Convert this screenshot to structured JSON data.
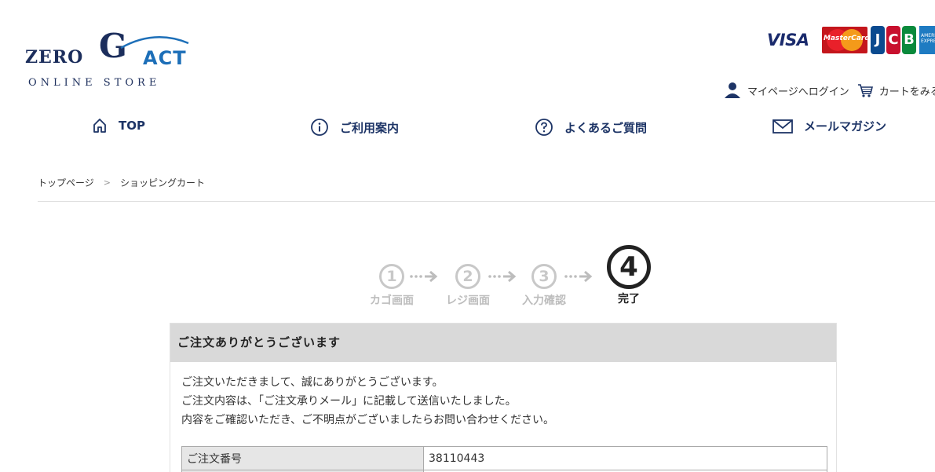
{
  "logo": {
    "main": "ZERO",
    "g": "G",
    "act": "ACT",
    "sub": "ONLINE STORE"
  },
  "cards": {
    "visa": "VISA",
    "mastercard": "MasterCard",
    "jcb": [
      "J",
      "C",
      "B"
    ],
    "amex": "AMERICAN EXPRESS"
  },
  "account": {
    "login": "マイページへログイン",
    "cart": "カートをみる"
  },
  "nav": [
    {
      "label": "TOP",
      "icon": "home-icon"
    },
    {
      "label": "ご利用案内",
      "icon": "info-icon"
    },
    {
      "label": "よくあるご質問",
      "icon": "question-icon"
    },
    {
      "label": "メールマガジン",
      "icon": "mail-icon"
    }
  ],
  "breadcrumb": {
    "items": [
      "トップページ",
      "ショッピングカート"
    ],
    "separator": ">"
  },
  "steps": [
    {
      "num": "1",
      "label": "カゴ画面"
    },
    {
      "num": "2",
      "label": "レジ画面"
    },
    {
      "num": "3",
      "label": "入力確認"
    },
    {
      "num": "4",
      "label": "完了"
    }
  ],
  "panel": {
    "title": "ご注文ありがとうございます",
    "lines": [
      "ご注文いただきまして、誠にありがとうございます。",
      "ご注文内容は、「ご注文承りメール」に記載して送信いたしました。",
      "内容をご確認いただき、ご不明点がございましたらお問い合わせください。"
    ],
    "order_label": "ご注文番号",
    "order_number": "38110443"
  },
  "colors": {
    "navy": "#1d3466",
    "step_active": "#222222",
    "step_inactive": "#c8c8c8",
    "panel_header": "#d9d9d9"
  }
}
